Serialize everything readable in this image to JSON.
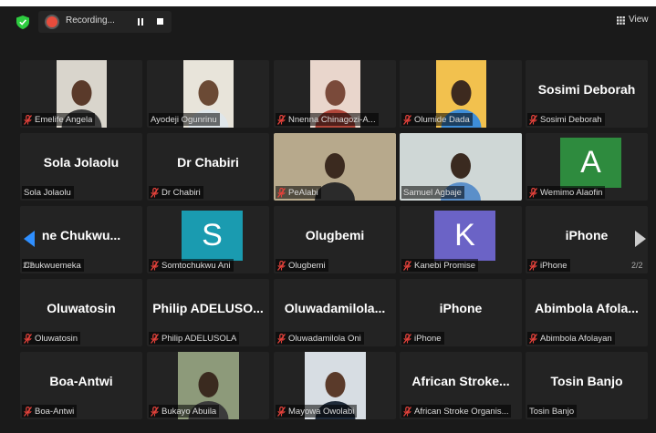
{
  "toolbar": {
    "recording_label": "Recording...",
    "view_label": "View",
    "page_indicator_left": "2/2",
    "page_indicator_right": "2/2"
  },
  "colors": {
    "recording": "#e74c3c",
    "shield": "#2ecc40",
    "nav_active": "#2f8fff",
    "muted": "#e5423b"
  },
  "tiles": [
    {
      "label": "Emelife Angela",
      "muted": true,
      "video": true
    },
    {
      "label": "Ayodeji Ogunrinu",
      "muted": false,
      "video": true
    },
    {
      "label": "Nnenna Chinagozi-A...",
      "muted": true,
      "video": true
    },
    {
      "label": "Olumide Dada",
      "muted": true,
      "video": true
    },
    {
      "name": "Sosimi Deborah",
      "label": "Sosimi Deborah",
      "muted": true
    },
    {
      "name": "Sola Jolaolu",
      "label": "Sola Jolaolu",
      "muted": false
    },
    {
      "name": "Dr Chabiri",
      "label": "Dr Chabiri",
      "muted": true
    },
    {
      "label": "PeAlabi",
      "muted": true,
      "video": true
    },
    {
      "label": "Samuel Agbaje",
      "muted": false,
      "video": true
    },
    {
      "avatar": "A",
      "avatar_color": "#2e8b3e",
      "label": "Wemimo Alaofin",
      "muted": true
    },
    {
      "name": "ne Chukwu...",
      "label": "Chukwuemeka",
      "muted": false
    },
    {
      "avatar": "S",
      "avatar_color": "#1a9bb0",
      "label": "Somtochukwu Ani",
      "muted": true
    },
    {
      "name": "Olugbemi",
      "label": "Olugbemi",
      "muted": true
    },
    {
      "avatar": "K",
      "avatar_color": "#6b63c6",
      "label": "Kanebi Promise",
      "muted": true
    },
    {
      "name": "iPhone",
      "label": "iPhone",
      "muted": true
    },
    {
      "name": "Oluwatosin",
      "label": "Oluwatosin",
      "muted": true
    },
    {
      "name": "Philip ADELUSO...",
      "label": "Philip ADELUSOLA",
      "muted": true
    },
    {
      "name": "Oluwadamilola...",
      "label": "Oluwadamilola Oni",
      "muted": true
    },
    {
      "name": "iPhone",
      "label": "iPhone",
      "muted": true
    },
    {
      "name": "Abimbola Afola...",
      "label": "Abimbola Afolayan",
      "muted": true
    },
    {
      "name": "Boa-Antwi",
      "label": "Boa-Antwi",
      "muted": true
    },
    {
      "label": "Bukayo Abuila",
      "muted": true,
      "video": true
    },
    {
      "label": "Mayowa Owolabi",
      "muted": true,
      "video": true
    },
    {
      "name": "African Stroke...",
      "label": "African Stroke Organis...",
      "muted": true
    },
    {
      "name": "Tosin Banjo",
      "label": "Tosin Banjo",
      "muted": false
    }
  ]
}
